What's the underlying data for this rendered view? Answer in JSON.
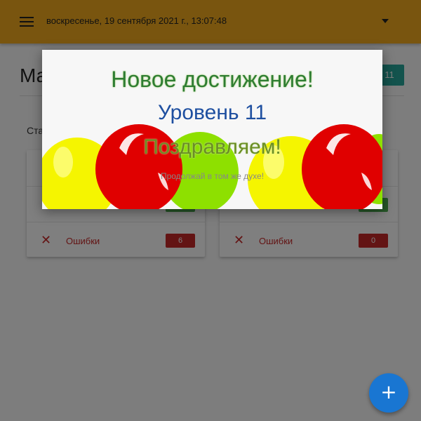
{
  "appbar": {
    "datetime": "воскресенье, 19 сентября 2021 г., 13:07:48",
    "menu_icon": "hamburger-icon",
    "dropdown_icon": "caret-down-icon",
    "bg_color": "#f2ab1e"
  },
  "page": {
    "title": "Ма",
    "level_badge": "11",
    "stats_label": "Ста"
  },
  "cards": [
    {
      "rows": [
        {
          "icon": "",
          "label": "",
          "count": ""
        },
        {
          "icon": "",
          "label": "",
          "count": ""
        },
        {
          "icon": "✕",
          "label": "Ошибки",
          "count": "6"
        }
      ]
    },
    {
      "rows": [
        {
          "icon": "",
          "label": "",
          "count": ""
        },
        {
          "icon": "",
          "label": "",
          "count": ""
        },
        {
          "icon": "✕",
          "label": "Ошибки",
          "count": "0"
        }
      ]
    }
  ],
  "modal": {
    "title": "Новое достижение!",
    "level": "Уровень 11",
    "congrats": "Поздравляем!",
    "subtitle": "Продолжай в том же духе!"
  },
  "fab": {
    "symbol": "+",
    "icon": "plus-icon"
  },
  "colors": {
    "accent": "#f2ab1e",
    "fab": "#1976d2",
    "error": "#c62828",
    "success": "#4caf50",
    "badge": "#26a69a"
  }
}
